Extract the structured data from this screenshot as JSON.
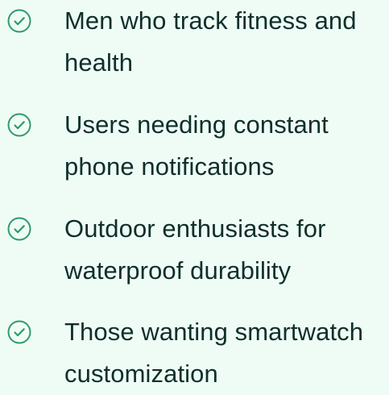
{
  "colors": {
    "background": "#effcf6",
    "text": "#0f2f2a",
    "accent": "#2f9b6a"
  },
  "items": [
    {
      "icon": "check-circle-icon",
      "label": "Men who track fitness and health"
    },
    {
      "icon": "check-circle-icon",
      "label": "Users needing constant phone notifications"
    },
    {
      "icon": "check-circle-icon",
      "label": "Outdoor enthusiasts for waterproof durability"
    },
    {
      "icon": "check-circle-icon",
      "label": "Those wanting smartwatch customization"
    }
  ]
}
